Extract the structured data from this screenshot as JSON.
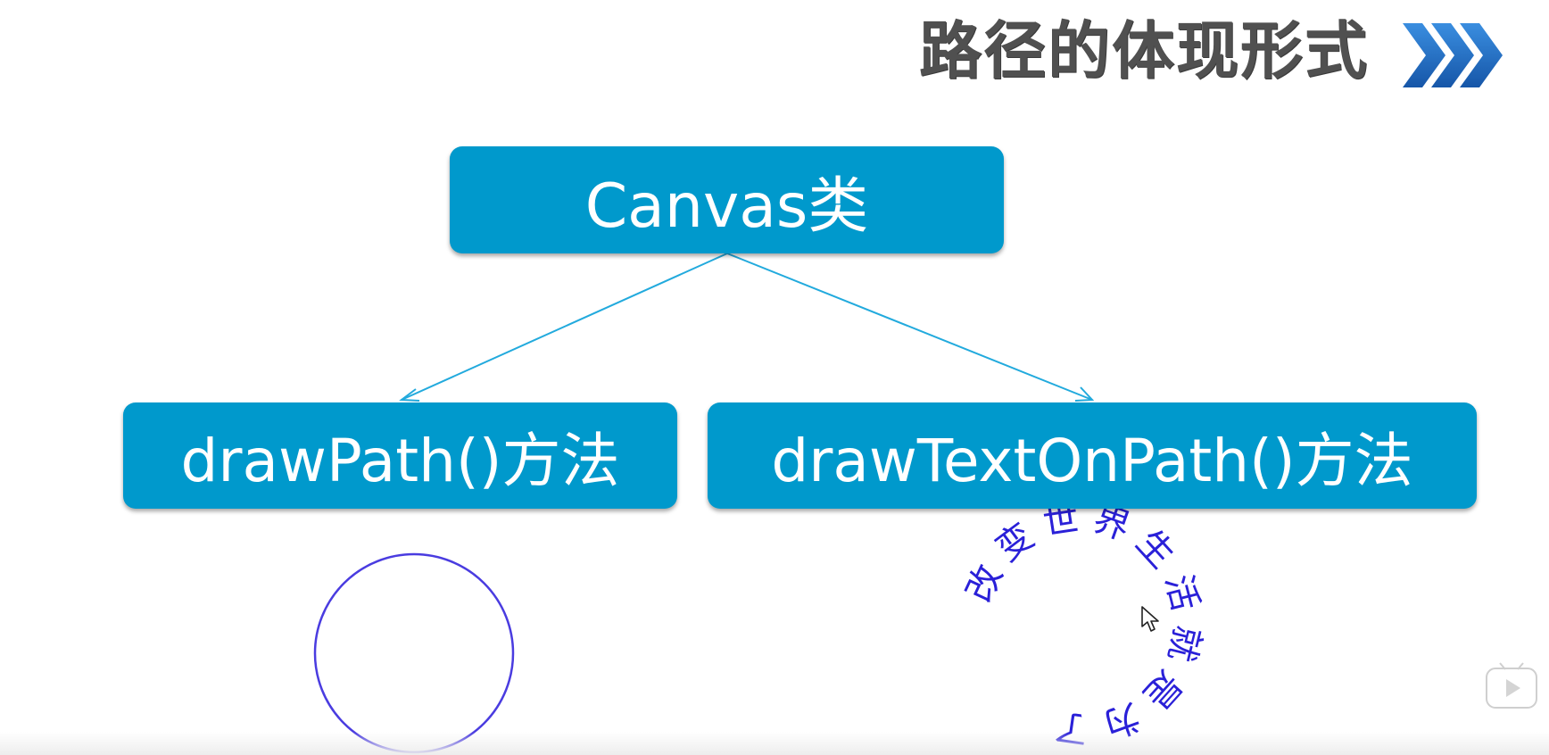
{
  "slide": {
    "title": "路径的体现形式",
    "title_icon": "triple-chevron-right-icon"
  },
  "diagram": {
    "root": {
      "label": "Canvas类"
    },
    "children": [
      {
        "label": "drawPath()方法"
      },
      {
        "label": "drawTextOnPath()方法"
      }
    ],
    "text_on_path": "改变世界生活就是为了",
    "colors": {
      "node_fill": "#0099cc",
      "node_text": "#ffffff",
      "connector": "#22aadd",
      "path_stroke": "#4a3ce0",
      "path_text": "#2a20d8",
      "title_text": "#505050",
      "chevron": "#1f6fc4"
    }
  },
  "overlay": {
    "cursor_icon": "mouse-pointer-icon",
    "player_icon": "video-play-icon"
  }
}
